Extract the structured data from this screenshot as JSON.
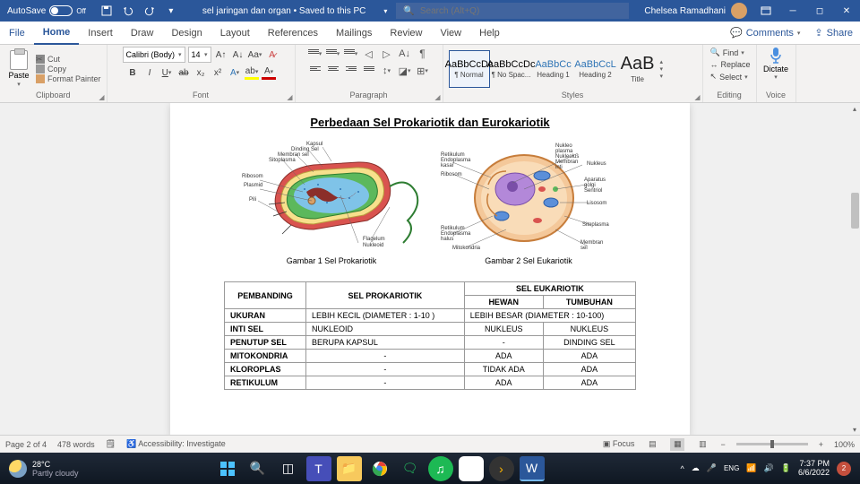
{
  "titlebar": {
    "autosave_label": "AutoSave",
    "autosave_state": "Off",
    "doc_name": "sel jaringan dan organ • Saved to this PC",
    "search_placeholder": "Search (Alt+Q)",
    "user": "Chelsea Ramadhani"
  },
  "tabs": {
    "file": "File",
    "home": "Home",
    "insert": "Insert",
    "draw": "Draw",
    "design": "Design",
    "layout": "Layout",
    "references": "References",
    "mailings": "Mailings",
    "review": "Review",
    "view": "View",
    "help": "Help",
    "comments": "Comments",
    "share": "Share"
  },
  "ribbon": {
    "clipboard": {
      "paste": "Paste",
      "cut": "Cut",
      "copy": "Copy",
      "painter": "Format Painter",
      "label": "Clipboard"
    },
    "font": {
      "name": "Calibri (Body)",
      "size": "14",
      "label": "Font"
    },
    "paragraph": {
      "label": "Paragraph"
    },
    "styles": {
      "label": "Styles",
      "items": [
        {
          "preview": "AaBbCcDc",
          "name": "¶ Normal",
          "cls": ""
        },
        {
          "preview": "AaBbCcDc",
          "name": "¶ No Spac...",
          "cls": ""
        },
        {
          "preview": "AaBbCc",
          "name": "Heading 1",
          "cls": "h"
        },
        {
          "preview": "AaBbCcL",
          "name": "Heading 2",
          "cls": "h"
        },
        {
          "preview": "AaB",
          "name": "Title",
          "cls": "big"
        }
      ]
    },
    "editing": {
      "find": "Find",
      "replace": "Replace",
      "select": "Select",
      "label": "Editing"
    },
    "voice": {
      "dictate": "Dictate",
      "label": "Voice"
    }
  },
  "document": {
    "title": "Perbedaan Sel Prokariotik dan Eurokariotik",
    "fig1_caption": "Gambar 1 Sel Prokariotik",
    "fig2_caption": "Gambar 2  Sel Eukariotik",
    "fig1_labels": {
      "kapsul": "Kapsul",
      "dinding": "Dinding Sel",
      "membran": "Membran sel",
      "sito": "Sitoplasma",
      "ribo": "Ribosom",
      "plasmid": "Plasmid",
      "pili": "Pili",
      "flag": "Flagelum",
      "nukleoid": "Nukleoid"
    },
    "fig2_labels": {
      "rek": "Retikulum",
      "endok": "Endoplasma",
      "kasar": "kasar",
      "ribo": "Ribosom",
      "reh": "Retikulum",
      "endoh": "Endoplasma",
      "halus": "halus",
      "mito": "Mitokondria",
      "nukleop": "Nukleo",
      "plasma": "plasma",
      "nukleolus": "Nukleolus",
      "membranI": "Membran",
      "inti": "inti",
      "nukleus": "Nukleus",
      "golgi": "Aparatus",
      "golgi2": "golgi",
      "sentriol": "Sentriol",
      "liso": "Lisosom",
      "sito": "Sitoplasma",
      "memsel": "Membran",
      "sel": "sel"
    },
    "table": {
      "h_pembanding": "PEMBANDING",
      "h_pro": "SEL PROKARIOTIK",
      "h_eu": "SEL EUKARIOTIK",
      "h_hewan": "HEWAN",
      "h_tumbuhan": "TUMBUHAN",
      "rows": [
        {
          "k": "UKURAN",
          "p": "LEBIH KECIL (DIAMETER : 1-10 )",
          "h": "LEBIH BESAR (DIAMETER : 10-100)",
          "t": ""
        },
        {
          "k": "INTI SEL",
          "p": "NUKLEOID",
          "h": "NUKLEUS",
          "t": "NUKLEUS"
        },
        {
          "k": "PENUTUP SEL",
          "p": "BERUPA KAPSUL",
          "h": "-",
          "t": "DINDING SEL"
        },
        {
          "k": "MITOKONDRIA",
          "p": "-",
          "h": "ADA",
          "t": "ADA"
        },
        {
          "k": "KLOROPLAS",
          "p": "-",
          "h": "TIDAK ADA",
          "t": "ADA"
        },
        {
          "k": "RETIKULUM",
          "p": "-",
          "h": "ADA",
          "t": "ADA"
        }
      ]
    }
  },
  "status": {
    "page": "Page 2 of 4",
    "words": "478 words",
    "acc": "Accessibility: Investigate",
    "focus": "Focus",
    "zoom": "100%"
  },
  "taskbar": {
    "temp": "28°C",
    "cond": "Partly cloudy",
    "time": "7:37 PM",
    "date": "6/6/2022",
    "notif": "2"
  }
}
